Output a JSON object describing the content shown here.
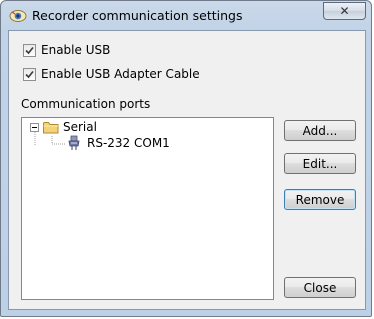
{
  "window": {
    "title": "Recorder communication settings",
    "close_glyph": "✕"
  },
  "options": {
    "enable_usb": {
      "label": "Enable USB",
      "checked": true
    },
    "enable_usb_adapter": {
      "label": "Enable USB Adapter Cable",
      "checked": true
    }
  },
  "ports": {
    "label": "Communication ports",
    "tree": {
      "root": {
        "label": "Serial",
        "expanded": true,
        "icon": "folder-icon"
      },
      "children": [
        {
          "label": "RS-232 COM1",
          "icon": "serial-port-icon"
        }
      ]
    }
  },
  "buttons": {
    "add": "Add...",
    "edit": "Edit...",
    "remove": "Remove",
    "close": "Close"
  },
  "colors": {
    "title_bar": "#c2d3e7",
    "dialog_bg": "#f0f0f0",
    "default_button_border": "#3c7fb1"
  }
}
